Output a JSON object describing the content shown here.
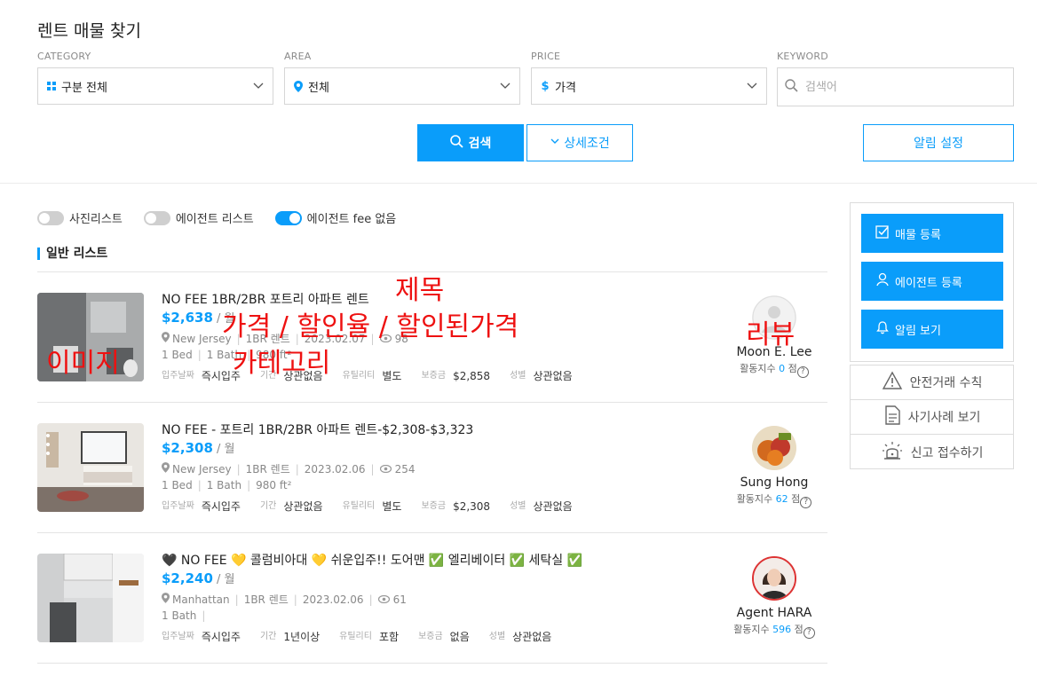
{
  "page_title": "렌트 매물 찾기",
  "filters": {
    "category": {
      "label": "CATEGORY",
      "value": "구분 전체"
    },
    "area": {
      "label": "AREA",
      "value": "전체"
    },
    "price": {
      "label": "PRICE",
      "value": "가격"
    },
    "keyword": {
      "label": "KEYWORD",
      "placeholder": "검색어"
    }
  },
  "buttons": {
    "search": "검색",
    "detail": "상세조건",
    "alert_setting": "알림 설정"
  },
  "toggles": [
    {
      "label": "사진리스트",
      "on": false
    },
    {
      "label": "에이전트 리스트",
      "on": false
    },
    {
      "label": "에이전트 fee 없음",
      "on": true
    }
  ],
  "section_title": "일반 리스트",
  "listings": [
    {
      "title": "NO FEE 1BR/2BR 포트리 아파트 렌트",
      "price": "$2,638",
      "price_unit": " / 월",
      "location": "New Jersey",
      "type": "1BR 렌트",
      "date": "2023.02.07",
      "views": "98",
      "bed": "1 Bed",
      "bath": "1 Bath",
      "size": "980 ft²",
      "movein_label": "입주날짜",
      "movein": "즉시입주",
      "period_label": "기간",
      "period": "상관없음",
      "utility_label": "유틸리티",
      "utility": "별도",
      "deposit_label": "보증금",
      "deposit": "$2,858",
      "gender_label": "성별",
      "gender": "상관없음",
      "agent_name": "Moon E. Lee",
      "agent_score_label": "활동지수",
      "agent_score": "0",
      "agent_score_unit": "점"
    },
    {
      "title": "NO FEE - 포트리 1BR/2BR 아파트 렌트-$2,308-$3,323",
      "price": "$2,308",
      "price_unit": " / 월",
      "location": "New Jersey",
      "type": "1BR 렌트",
      "date": "2023.02.06",
      "views": "254",
      "bed": "1 Bed",
      "bath": "1 Bath",
      "size": "980 ft²",
      "movein_label": "입주날짜",
      "movein": "즉시입주",
      "period_label": "기간",
      "period": "상관없음",
      "utility_label": "유틸리티",
      "utility": "별도",
      "deposit_label": "보증금",
      "deposit": "$2,308",
      "gender_label": "성별",
      "gender": "상관없음",
      "agent_name": "Sung Hong",
      "agent_score_label": "활동지수",
      "agent_score": "62",
      "agent_score_unit": "점"
    },
    {
      "title": "🖤 NO FEE 💛 콜럼비아대 💛 쉬운입주!! 도어맨 ✅ 엘리베이터 ✅ 세탁실 ✅",
      "price": "$2,240",
      "price_unit": " / 월",
      "location": "Manhattan",
      "type": "1BR 렌트",
      "date": "2023.02.06",
      "views": "61",
      "bath": "1 Bath",
      "movein_label": "입주날짜",
      "movein": "즉시입주",
      "period_label": "기간",
      "period": "1년이상",
      "utility_label": "유틸리티",
      "utility": "포함",
      "deposit_label": "보증금",
      "deposit": "없음",
      "gender_label": "성별",
      "gender": "상관없음",
      "agent_name": "Agent HARA",
      "agent_score_label": "활동지수",
      "agent_score": "596",
      "agent_score_unit": "점"
    }
  ],
  "side_buttons": {
    "register_listing": "매물 등록",
    "register_agent": "에이전트 등록",
    "view_alerts": "알림 보기"
  },
  "safety": {
    "guide": "안전거래 수칙",
    "fraud": "사기사례 보기",
    "report": "신고 접수하기"
  },
  "annotations": {
    "title": "제목",
    "price": "가격 / 할인율 / 할인된가격",
    "category": "카테고리",
    "image": "이미지",
    "review": "리뷰"
  },
  "colors": {
    "accent": "#0a9dfa",
    "annotation": "#ee1111"
  }
}
